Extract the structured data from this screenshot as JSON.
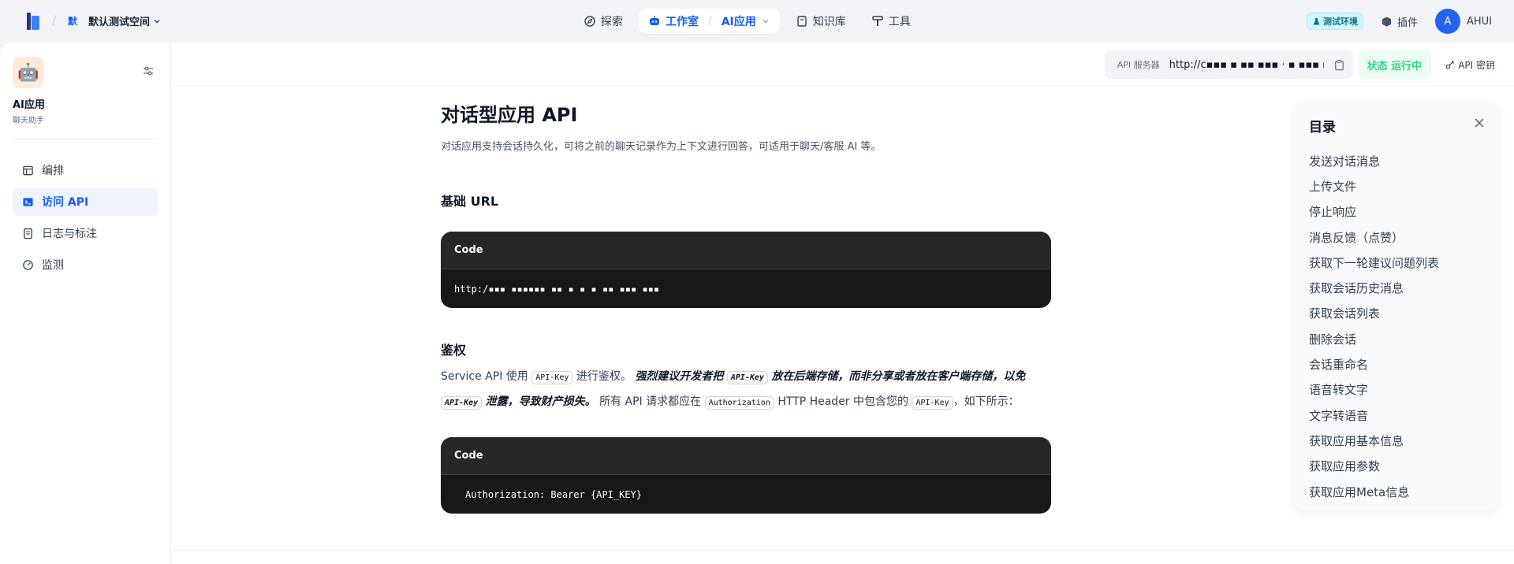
{
  "topbar": {
    "workspace_avatar": "默",
    "workspace_name": "默认测试空间",
    "nav": {
      "explore": "探索",
      "studio": "工作室",
      "studio_sub": "AI应用",
      "knowledge": "知识库",
      "tools": "工具"
    },
    "env_badge": "测试环境",
    "plugins": "插件",
    "user_initial": "A",
    "user_name": "AHUI"
  },
  "sidebar": {
    "app_name": "AI应用",
    "app_type": "聊天助手",
    "items": [
      {
        "label": "编排",
        "icon": "layout-icon"
      },
      {
        "label": "访问 API",
        "icon": "terminal-icon",
        "active": true
      },
      {
        "label": "日志与标注",
        "icon": "file-list-icon"
      },
      {
        "label": "监测",
        "icon": "dashboard-icon"
      }
    ]
  },
  "api_bar": {
    "server_label": "API 服务器",
    "server_url": "http://c▪▪▪ ▪ ▪▪ ▪▪▪ · ▪ ▪▪▪ ▪",
    "status": "状态 运行中",
    "api_key": "API 密钥"
  },
  "doc": {
    "title": "对话型应用 API",
    "description": "对话应用支持会话持久化，可将之前的聊天记录作为上下文进行回答，可适用于聊天/客服 AI 等。",
    "base_url_heading": "基础 URL",
    "code_label": "Code",
    "base_url_value": "http:/▪▪▪ ▪▪▪▪▪▪ ▪▪ ▪ ▪ ▪ ▪▪ ▪▪▪ ▪▪▪",
    "auth_heading": "鉴权",
    "auth_p1": "Service API 使用",
    "api_key_code": "API-Key",
    "auth_p2": "进行鉴权。",
    "auth_strong1": "强烈建议开发者把",
    "auth_strong2": "放在后端存储，而非分享或者放在客户端存储，以免",
    "auth_strong3": "泄露，导致财产损失。",
    "auth_p3": "所有 API 请求都应在",
    "authorization_code": "Authorization",
    "auth_p4": "HTTP Header 中包含您的",
    "auth_p5": "，如下所示：",
    "auth_code_value": "Authorization: Bearer {API_KEY}"
  },
  "toc": {
    "title": "目录",
    "items": [
      "发送对话消息",
      "上传文件",
      "停止响应",
      "消息反馈（点赞）",
      "获取下一轮建议问题列表",
      "获取会话历史消息",
      "获取会话列表",
      "删除会话",
      "会话重命名",
      "语音转文字",
      "文字转语音",
      "获取应用基本信息",
      "获取应用参数",
      "获取应用Meta信息"
    ]
  },
  "colors": {
    "accent": "#155eef",
    "status_green": "#32d583",
    "code_bg": "#18181b"
  }
}
